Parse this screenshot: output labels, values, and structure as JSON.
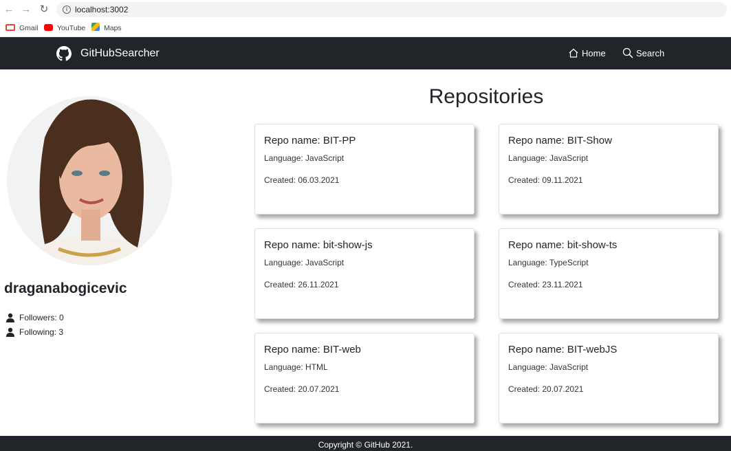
{
  "browser": {
    "url": "localhost:3002",
    "bookmarks": [
      "Gmail",
      "YouTube",
      "Maps"
    ]
  },
  "navbar": {
    "brand": "GitHubSearcher",
    "links": [
      "Home",
      "Search"
    ]
  },
  "profile": {
    "username": "draganabogicevic",
    "followers": "Followers: 0",
    "following": "Following: 3"
  },
  "repositories": {
    "heading": "Repositories",
    "items": [
      {
        "name": "Repo name: BIT-PP",
        "language": "Language: JavaScript",
        "created": "Created: 06.03.2021"
      },
      {
        "name": "Repo name: BIT-Show",
        "language": "Language: JavaScript",
        "created": "Created: 09.11.2021"
      },
      {
        "name": "Repo name: bit-show-js",
        "language": "Language: JavaScript",
        "created": "Created: 26.11.2021"
      },
      {
        "name": "Repo name: bit-show-ts",
        "language": "Language: TypeScript",
        "created": "Created: 23.11.2021"
      },
      {
        "name": "Repo name: BIT-web",
        "language": "Language: HTML",
        "created": "Created: 20.07.2021"
      },
      {
        "name": "Repo name: BIT-webJS",
        "language": "Language: JavaScript",
        "created": "Created: 20.07.2021"
      }
    ]
  },
  "footer": {
    "text": "Copyright © GitHub 2021."
  },
  "colors": {
    "navbar_bg": "#212529",
    "text": "#212529"
  }
}
